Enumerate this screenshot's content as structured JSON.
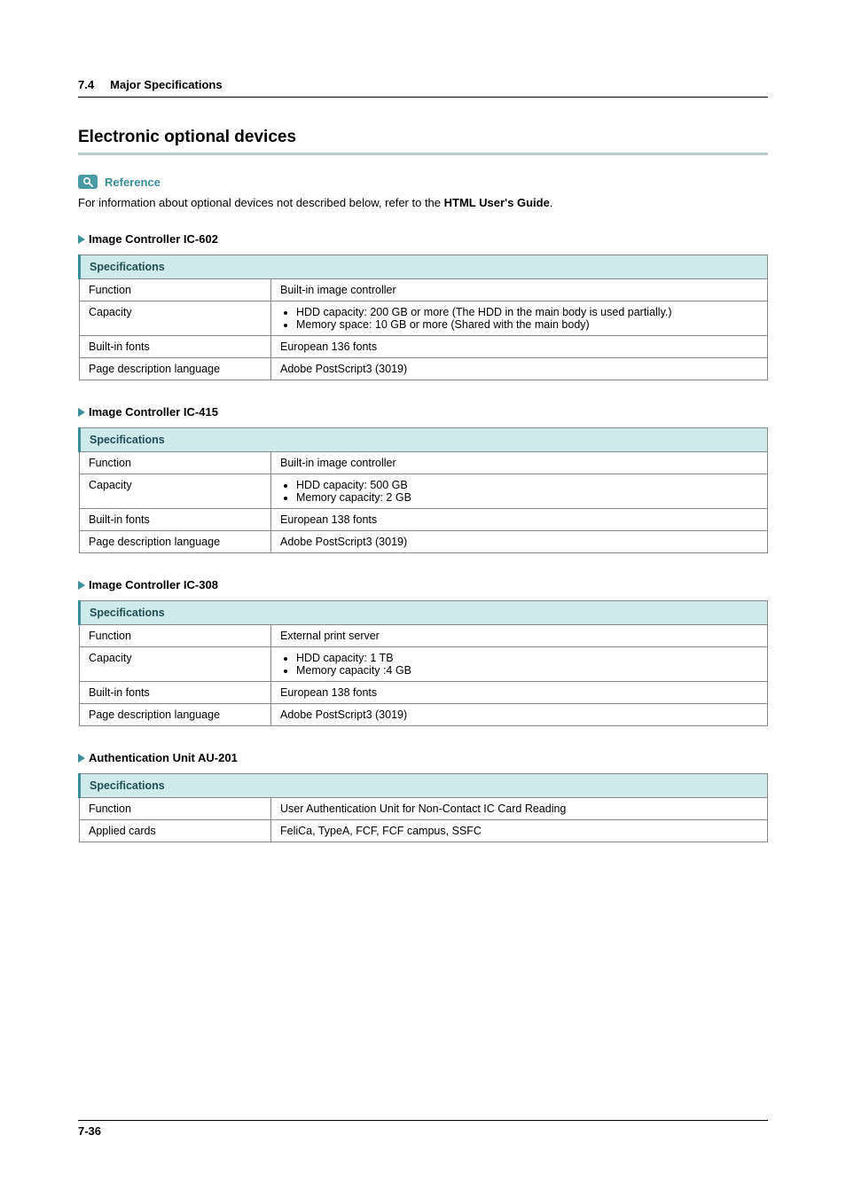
{
  "header": {
    "section_no": "7.4",
    "section_title": "Major Specifications"
  },
  "main_title": "Electronic optional devices",
  "reference": {
    "label": "Reference",
    "text_pre": "For information about optional devices not described below, refer to the ",
    "text_bold": "HTML User's Guide",
    "text_post": "."
  },
  "tables": [
    {
      "title": "Image Controller IC-602",
      "header": "Specifications",
      "rows": [
        {
          "k": "Function",
          "v": "Built-in image controller"
        },
        {
          "k": "Capacity",
          "bullets": [
            "HDD capacity: 200 GB or more (The HDD in the main body is used partially.)",
            "Memory space: 10 GB or more (Shared with the main body)"
          ]
        },
        {
          "k": "Built-in fonts",
          "v": "European 136 fonts"
        },
        {
          "k": "Page description language",
          "v": "Adobe PostScript3 (3019)"
        }
      ]
    },
    {
      "title": "Image Controller IC-415",
      "header": "Specifications",
      "rows": [
        {
          "k": "Function",
          "v": "Built-in image controller"
        },
        {
          "k": "Capacity",
          "bullets": [
            "HDD capacity: 500 GB",
            "Memory capacity: 2 GB"
          ]
        },
        {
          "k": "Built-in fonts",
          "v": "European 138 fonts"
        },
        {
          "k": "Page description language",
          "v": "Adobe PostScript3 (3019)"
        }
      ]
    },
    {
      "title": "Image Controller IC-308",
      "header": "Specifications",
      "rows": [
        {
          "k": "Function",
          "v": "External print server"
        },
        {
          "k": "Capacity",
          "bullets": [
            "HDD capacity: 1 TB",
            "Memory capacity :4 GB"
          ]
        },
        {
          "k": "Built-in fonts",
          "v": "European 138 fonts"
        },
        {
          "k": "Page description language",
          "v": "Adobe PostScript3 (3019)"
        }
      ]
    },
    {
      "title": "Authentication Unit AU-201",
      "header": "Specifications",
      "rows": [
        {
          "k": "Function",
          "v": "User Authentication Unit for Non-Contact IC Card Reading"
        },
        {
          "k": "Applied cards",
          "v": "FeliCa, TypeA, FCF, FCF campus, SSFC"
        }
      ]
    }
  ],
  "footer": {
    "page_no": "7-36"
  }
}
